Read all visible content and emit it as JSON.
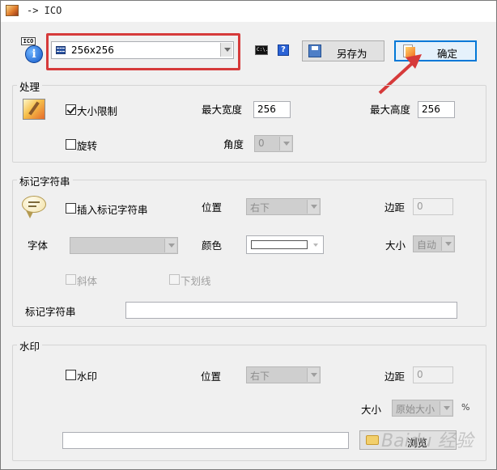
{
  "window": {
    "title": "-> ICO"
  },
  "top": {
    "size_combo_value": "256x256",
    "cmd_icon_text": "C:\\.",
    "help_icon_text": "?",
    "save_as_label": "另存为",
    "ok_label": "确定"
  },
  "processing": {
    "group_title": "处理",
    "size_limit_label": "大小限制",
    "size_limit_checked": true,
    "max_width_label": "最大宽度",
    "max_width_value": "256",
    "max_height_label": "最大高度",
    "max_height_value": "256",
    "rotate_label": "旋转",
    "rotate_checked": false,
    "angle_label": "角度",
    "angle_value": "0"
  },
  "tag_string": {
    "group_title": "标记字符串",
    "insert_label": "插入标记字符串",
    "insert_checked": false,
    "position_label": "位置",
    "position_value": "右下",
    "margin_label": "边距",
    "margin_value": "0",
    "font_label": "字体",
    "font_value": "",
    "color_label": "颜色",
    "size_label": "大小",
    "size_value": "自动",
    "italic_label": "斜体",
    "underline_label": "下划线",
    "text_label": "标记字符串",
    "text_value": ""
  },
  "watermark": {
    "group_title": "水印",
    "watermark_label": "水印",
    "watermark_checked": false,
    "position_label": "位置",
    "position_value": "右下",
    "margin_label": "边距",
    "margin_value": "0",
    "size_label": "大小",
    "size_value": "原始大小",
    "percent_symbol": "%",
    "file_path_value": "",
    "browse_label": "浏览"
  },
  "overlay": {
    "watermark_text": "Baidu 经验"
  },
  "colors": {
    "annotation_red": "#d63a3a",
    "dialog_bg": "#f0f0f0"
  }
}
